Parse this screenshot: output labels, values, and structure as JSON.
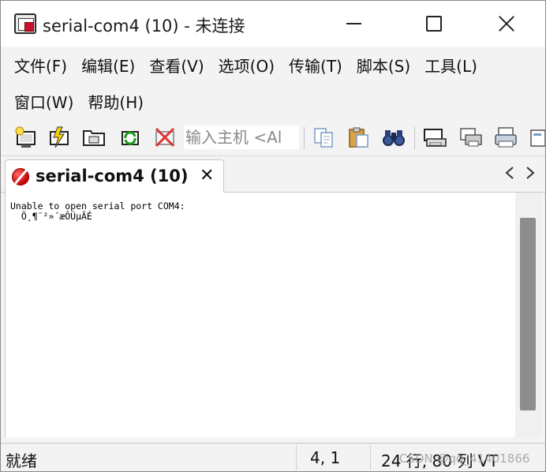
{
  "window": {
    "title": "serial-com4 (10) - 未连接"
  },
  "menu": {
    "row1": [
      "文件(F)",
      "编辑(E)",
      "查看(V)",
      "选项(O)",
      "传输(T)",
      "脚本(S)",
      "工具(L)"
    ],
    "row2": [
      "窗口(W)",
      "帮助(H)"
    ]
  },
  "toolbar": {
    "host_placeholder": "输入主机 <Al",
    "icons": [
      "connect-icon",
      "quick-connect-icon",
      "connect-in-tab-icon",
      "reconnect-icon",
      "disconnect-icon",
      "copy-icon",
      "paste-icon",
      "find-icon",
      "print-icon",
      "print-setup-icon",
      "printer-icon",
      "options-icon"
    ]
  },
  "tab": {
    "label": "serial-com4 (10)",
    "close_glyph": "✕"
  },
  "terminal": {
    "lines": [
      "Unable to open serial port COM4:",
      "  Ö¸¶¨²»´æÔÚµÄÉ"
    ]
  },
  "status": {
    "ready": "就绪",
    "position": "4,   1",
    "size": "24 行, 80 列  VT"
  },
  "watermark": "CSDN @qq_41401866",
  "colors": {
    "background": "#f3f3f3",
    "terminal_bg": "#ffffff",
    "scroll_thumb": "#8d8d8d"
  }
}
